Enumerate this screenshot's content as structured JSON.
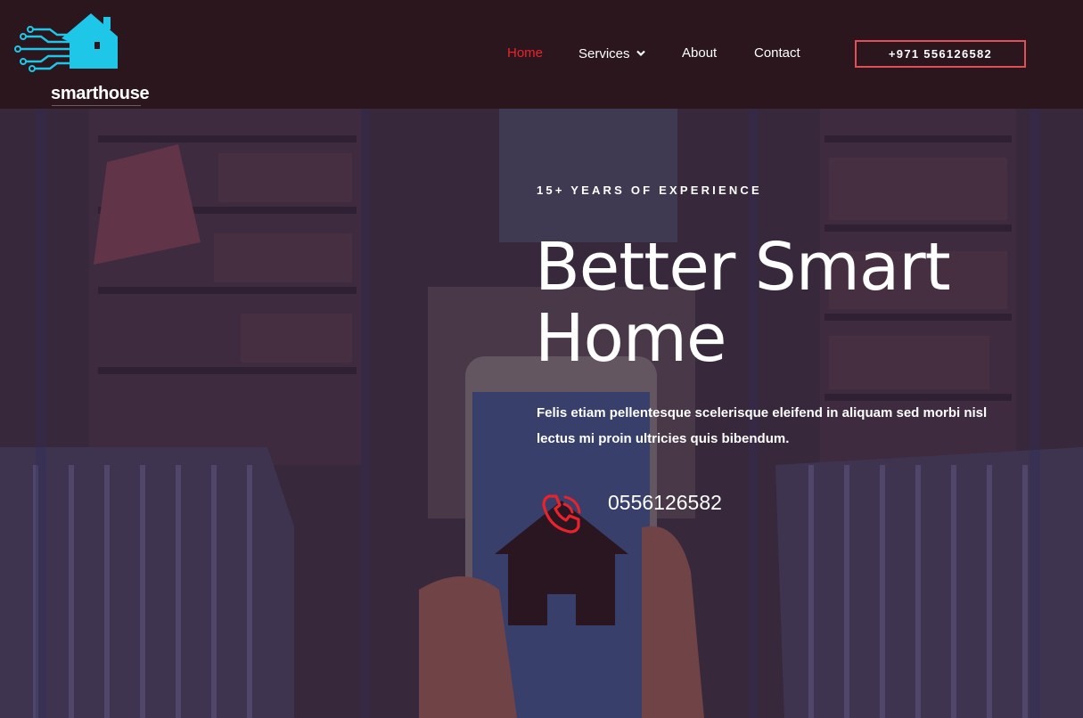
{
  "header": {
    "logo_text": "smarthouse",
    "logo_icon": "circuit-house-icon",
    "nav": [
      {
        "label": "Home",
        "active": true
      },
      {
        "label": "Services",
        "has_dropdown": true
      },
      {
        "label": "About"
      },
      {
        "label": "Contact"
      }
    ],
    "phone_button": "+971 556126582"
  },
  "hero": {
    "eyebrow": "15+ YEARS OF EXPERIENCE",
    "headline_line1": "Better Smart",
    "headline_line2": "Home",
    "subtext": "Felis etiam pellentesque scelerisque eleifend in aliquam sed morbi nisl lectus mi proin ultricies quis bibendum.",
    "call_icon": "phone-ring-icon",
    "call_number": "0556126582"
  },
  "colors": {
    "header_bg": "#2b161d",
    "accent_red": "#e8232b",
    "button_border": "#e04f55",
    "logo_cyan": "#1ec7e8",
    "text": "#ffffff"
  }
}
